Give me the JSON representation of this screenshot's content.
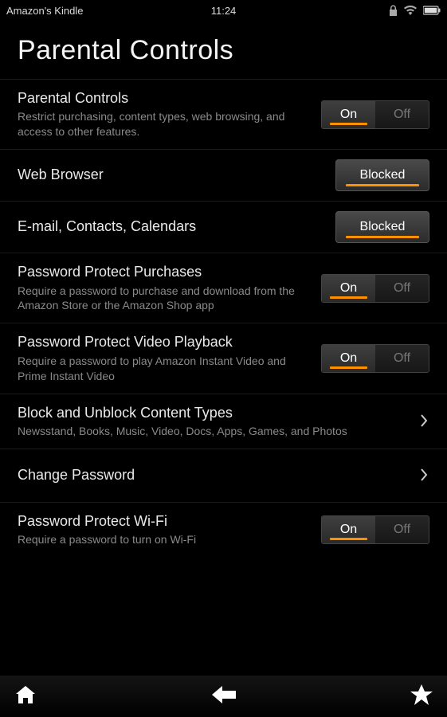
{
  "status": {
    "appName": "Amazon's Kindle",
    "time": "11:24"
  },
  "pageTitle": "Parental Controls",
  "rows": {
    "parentalControls": {
      "title": "Parental Controls",
      "desc": "Restrict purchasing, content types, web browsing, and access to other features.",
      "on": "On",
      "off": "Off",
      "state": "on"
    },
    "webBrowser": {
      "title": "Web Browser",
      "button": "Blocked"
    },
    "emailContacts": {
      "title": "E-mail, Contacts, Calendars",
      "button": "Blocked"
    },
    "passwordPurchases": {
      "title": "Password Protect Purchases",
      "desc": "Require a password to purchase and download from the Amazon Store or the Amazon Shop app",
      "on": "On",
      "off": "Off",
      "state": "on"
    },
    "passwordVideo": {
      "title": "Password Protect Video Playback",
      "desc": "Require a password to play Amazon Instant Video and Prime Instant Video",
      "on": "On",
      "off": "Off",
      "state": "on"
    },
    "blockContent": {
      "title": "Block and Unblock Content Types",
      "desc": "Newsstand, Books, Music, Video, Docs, Apps, Games, and Photos"
    },
    "changePassword": {
      "title": "Change Password"
    },
    "passwordWifi": {
      "title": "Password Protect Wi-Fi",
      "desc": "Require a password to turn on Wi-Fi",
      "on": "On",
      "off": "Off",
      "state": "on"
    }
  }
}
